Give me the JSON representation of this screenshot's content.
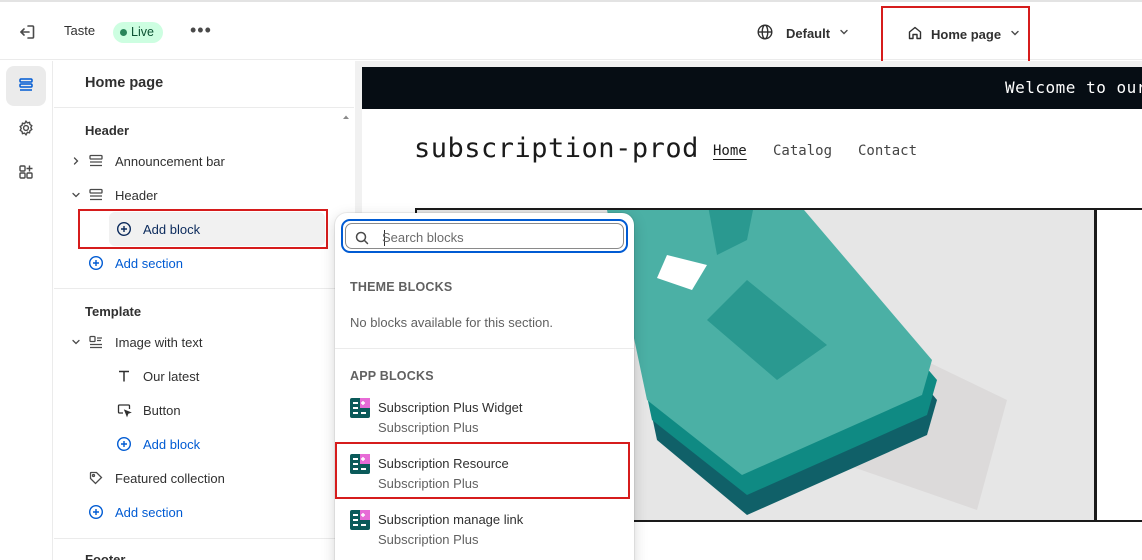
{
  "topbar": {
    "title": "Taste",
    "status": "Live",
    "more": "•••",
    "theme_select": "Default",
    "page_select": "Home page"
  },
  "sidebar": {
    "heading": "Home page",
    "header_section": {
      "title": "Header",
      "items": [
        "Announcement bar",
        "Header"
      ],
      "add_block": "Add block",
      "add_section": "Add section"
    },
    "template_section": {
      "title": "Template",
      "image_with_text": "Image with text",
      "children": [
        "Our latest",
        "Button"
      ],
      "add_block": "Add block",
      "featured": "Featured collection",
      "add_section": "Add section"
    },
    "footer_section": {
      "title": "Footer"
    }
  },
  "picker": {
    "search_placeholder": "Search blocks",
    "theme_blocks_title": "THEME BLOCKS",
    "theme_blocks_empty": "No blocks available for this section.",
    "app_blocks_title": "APP BLOCKS",
    "app_blocks": [
      {
        "name": "Subscription Plus Widget",
        "app": "Subscription Plus"
      },
      {
        "name": "Subscription Resource",
        "app": "Subscription Plus"
      },
      {
        "name": "Subscription manage link",
        "app": "Subscription Plus"
      }
    ]
  },
  "preview": {
    "announcement": "Welcome to our",
    "store_name": "subscription-prod",
    "nav": [
      "Home",
      "Catalog",
      "Contact"
    ]
  },
  "colors": {
    "accent_blue": "#005bd3",
    "highlight_red": "#d61c1c",
    "live_badge_bg": "#cdfee1",
    "announcement_bg": "#060d14",
    "shirt_teal": "#4bb0a5"
  }
}
